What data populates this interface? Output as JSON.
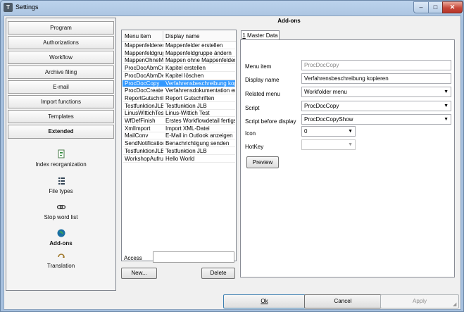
{
  "window": {
    "title": "Settings",
    "app_icon": "T",
    "min_glyph": "–",
    "max_glyph": "□",
    "close_glyph": "✕"
  },
  "section_title": "Add-ons",
  "sidebar": {
    "nav": [
      "Program",
      "Authorizations",
      "Workflow",
      "Archive filing",
      "E-mail",
      "Import functions",
      "Templates",
      "Extended"
    ],
    "active_nav": "Extended",
    "sub_items": [
      {
        "label": "Index reorganization",
        "icon": "index-document-icon"
      },
      {
        "label": "File types",
        "icon": "list-icon"
      },
      {
        "label": "Stop word list",
        "icon": "chain-link-icon"
      },
      {
        "label": "Add-ons",
        "icon": "globe-icon"
      },
      {
        "label": "Translation",
        "icon": "translation-icon"
      }
    ],
    "active_sub": "Add-ons"
  },
  "list": {
    "columns": [
      "Menu item",
      "Display name"
    ],
    "rows": [
      [
        "Mappenfeldererst",
        "Mappenfelder erstellen"
      ],
      [
        "Mappenfeldgrupp",
        "Mappenfeldgruppe ändern"
      ],
      [
        "MappenOhneMap",
        "Mappen ohne Mappenfelder"
      ],
      [
        "ProcDocAbmCrea",
        "Kapitel erstellen"
      ],
      [
        "ProcDocAbmDele",
        "Kapitel löschen"
      ],
      [
        "ProcDocCopy",
        "Verfahrensbeschreibung kopieren"
      ],
      [
        "ProcDocCreateDo",
        "Verfahrensdokumentation erstellen"
      ],
      [
        "ReportGutschrift",
        "Report Gutschriften"
      ],
      [
        "TestfunktionJLBAb",
        "Testfunktion JLB"
      ],
      [
        "LinusWittichTest",
        "Linus-Wittich Test"
      ],
      [
        "WfDefFinish",
        "Erstes Workflowdetail fertigstellen"
      ],
      [
        "XmlImport",
        "Import XML-Datei"
      ],
      [
        "MailConv",
        "E-Mail in Outlook anzeigen"
      ],
      [
        "SendNotification",
        "Benachrichtigung senden"
      ],
      [
        "TestfunktionJLB",
        "Testfunktion JLB"
      ],
      [
        "WorkshopAufruf",
        "Hello World"
      ]
    ],
    "selected_index": 5
  },
  "access": {
    "label": "Access",
    "value": ""
  },
  "buttons": {
    "new": "New...",
    "delete": "Delete",
    "preview": "Preview",
    "ok": "Ok",
    "cancel": "Cancel",
    "apply": "Apply"
  },
  "tab": {
    "number": "1",
    "label": " Master Data"
  },
  "form": {
    "menu_item": {
      "label": "Menu item",
      "value": "ProcDocCopy"
    },
    "display_name": {
      "label": "Display name",
      "value": "Verfahrensbeschreibung kopieren"
    },
    "related_menu": {
      "label": "Related menu",
      "value": "Workfolder menu"
    },
    "script": {
      "label": "Script",
      "value": "ProcDocCopy"
    },
    "script_before_display": {
      "label": "Script before display",
      "value": "ProcDocCopyShow"
    },
    "icon": {
      "label": "Icon",
      "value": "0"
    },
    "hotkey": {
      "label": "HotKey",
      "value": ""
    }
  },
  "colors": {
    "selection": "#3399ff",
    "title_bar": "#a6c0de",
    "close_button": "#c7483a"
  }
}
